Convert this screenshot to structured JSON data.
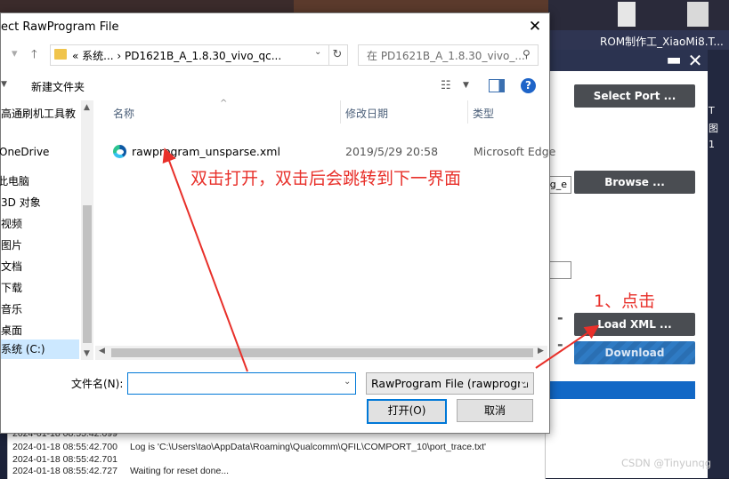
{
  "background": {
    "app_title": "ROM制作工_XiaoMi8.T...",
    "right_edge_chars": [
      "T",
      "图",
      "1"
    ]
  },
  "qfil": {
    "select_port_label": "Select Port ...",
    "browse_label": "Browse ...",
    "field_partial_text": "og_e",
    "load_xml_label": "Load XML ...",
    "download_label": "Download"
  },
  "log": {
    "lines": [
      {
        "time": "2024-01-18 08:55:42.699",
        "text": ""
      },
      {
        "time": "2024-01-18 08:55:42.700",
        "text": "Log is 'C:\\Users\\tao\\AppData\\Roaming\\Qualcomm\\QFIL\\COMPORT_10\\port_trace.txt'"
      },
      {
        "time": "2024-01-18 08:55:42.701",
        "text": ""
      },
      {
        "time": "2024-01-18 08:55:42.727",
        "text": "Waiting for reset done..."
      }
    ]
  },
  "dialog": {
    "title": "ect RawProgram File",
    "address_path": "«  系统...  ›  PD1621B_A_1.8.30_vivo_qc...",
    "search_placeholder": "在 PD1621B_A_1.8.30_vivo_...",
    "new_folder_label": "新建文件夹",
    "sidebar": [
      {
        "label": "高通刷机工具教",
        "selected": false
      },
      {
        "label": "OneDrive",
        "selected": false
      },
      {
        "label": "此电脑",
        "selected": false
      },
      {
        "label": "3D 对象",
        "selected": false
      },
      {
        "label": "视频",
        "selected": false
      },
      {
        "label": "图片",
        "selected": false
      },
      {
        "label": "文档",
        "selected": false
      },
      {
        "label": "下载",
        "selected": false
      },
      {
        "label": "音乐",
        "selected": false
      },
      {
        "label": "桌面",
        "selected": false
      },
      {
        "label": "系统 (C:)",
        "selected": true
      }
    ],
    "columns": {
      "name": "名称",
      "date": "修改日期",
      "type": "类型"
    },
    "files": [
      {
        "name": "rawprogram_unsparse.xml",
        "date": "2019/5/29 20:58",
        "type": "Microsoft Edge"
      }
    ],
    "filename_label": "文件名(N):",
    "filename_value": "",
    "filetype_value": "RawProgram File (rawprogra",
    "open_label": "打开(O)",
    "cancel_label": "取消"
  },
  "annotations": {
    "double_click_note": "双击打开，双击后会跳转到下一界面",
    "step1_note": "1、点击",
    "color": "#e8302a"
  },
  "watermark": "CSDN @Tinyunqg"
}
